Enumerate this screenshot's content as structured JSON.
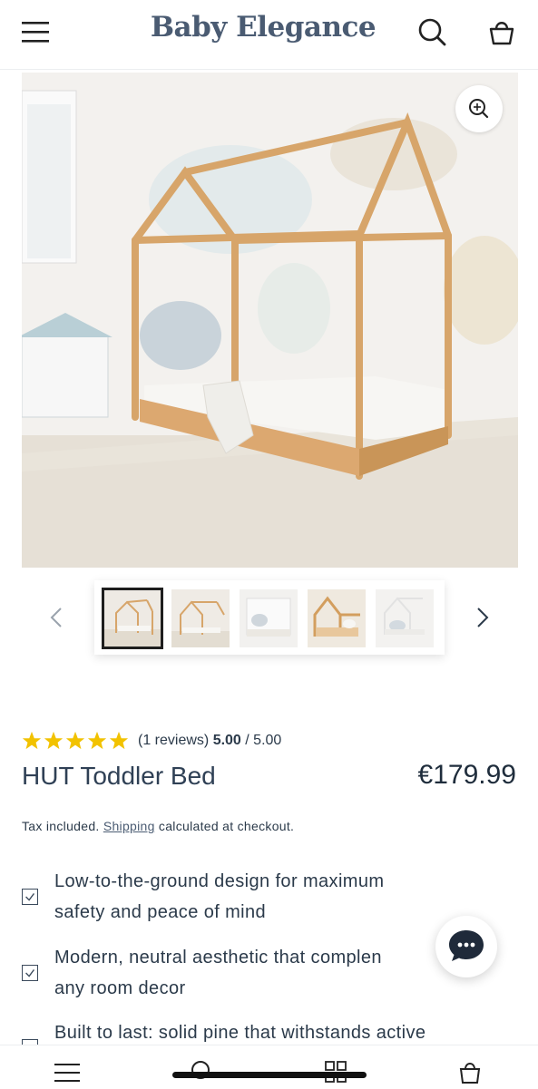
{
  "header": {
    "brand": "Baby Elegance",
    "menu_icon": "hamburger-menu-icon",
    "search_icon": "search-icon",
    "cart_icon": "shopping-bag-icon"
  },
  "gallery": {
    "zoom_icon": "zoom-in-icon",
    "prev_icon": "chevron-left-icon",
    "next_icon": "chevron-right-icon",
    "thumbnail_count": 5,
    "active_thumbnail": 1
  },
  "product": {
    "rating_stars": 5,
    "reviews_label": "(1 reviews)",
    "rating_value": "5.00",
    "rating_max": "/ 5.00",
    "title": "HUT Toddler Bed",
    "price": "€179.99",
    "tax_prefix": "Tax included.",
    "tax_link": "Shipping",
    "tax_suffix": "calculated at checkout."
  },
  "features": [
    {
      "line1": "Low-to-the-ground design for maximum",
      "line2": "safety and peace of mind"
    },
    {
      "line1": "Modern, neutral aesthetic that complen",
      "line2": "any room decor"
    },
    {
      "line1": "Built to last: solid pine that withstands active",
      "line2": ""
    }
  ],
  "chat": {
    "icon": "chat-bubble-icon"
  },
  "bottom_nav": {
    "items": [
      "menu-icon",
      "search-icon",
      "grid-icon",
      "bag-icon"
    ]
  },
  "colors": {
    "brand": "#4a5b72",
    "star": "#f2c200",
    "text": "#2b3a4a"
  }
}
